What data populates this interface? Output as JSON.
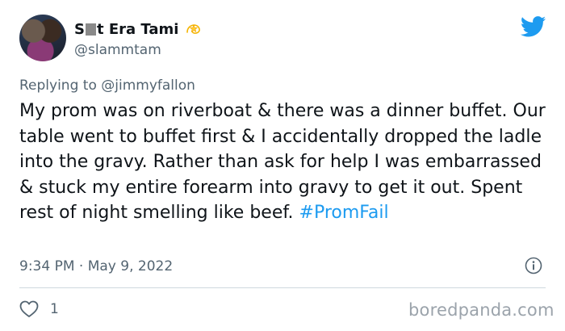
{
  "author": {
    "name_start": "S",
    "name_end": "t Era Tami",
    "handle": "@slammtam",
    "badge_icon": "dizzy-star-icon"
  },
  "reply": {
    "prefix": "Replying to",
    "mention": "@jimmyfallon"
  },
  "tweet": {
    "text": "My prom was on riverboat & there was a dinner buffet. Our table went to buffet first & I accidentally dropped the ladle into the gravy. Rather than ask for help I was embarrassed & stuck my entire forearm into gravy to get it out. Spent rest of night smelling like beef.",
    "hashtag": "#PromFail"
  },
  "meta": {
    "time": "9:34 PM",
    "separator": "·",
    "date": "May 9, 2022"
  },
  "actions": {
    "likes": "1"
  },
  "watermark": "boredpanda.com",
  "colors": {
    "brand": "#1d9bf0",
    "text": "#0f1419",
    "muted": "#536471",
    "divider": "#cfd9de"
  }
}
